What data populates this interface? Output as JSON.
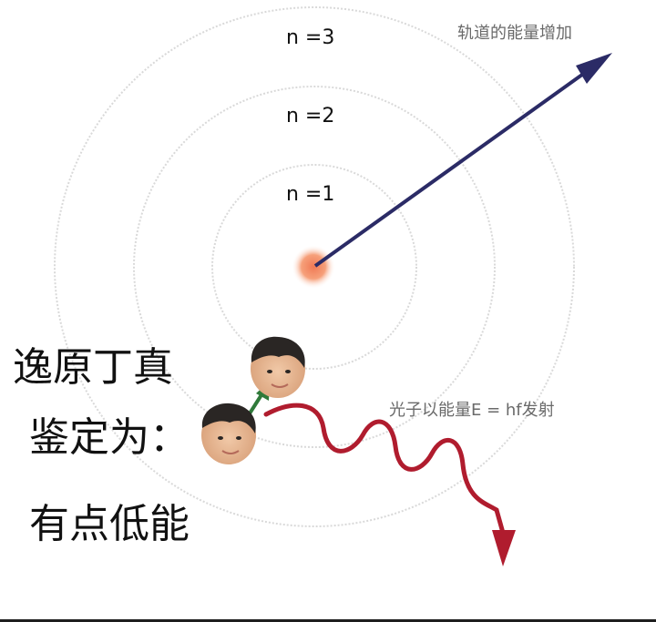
{
  "diagram": {
    "levels": [
      {
        "label": "n =1"
      },
      {
        "label": "n =2"
      },
      {
        "label": "n =3"
      }
    ],
    "arrow_label": "轨道的能量增加",
    "photon_label": "光子以能量E  =  hf发射",
    "caption_lines": [
      "逸原丁真",
      "鉴定为：",
      "有点低能"
    ],
    "colors": {
      "orbit": "#d8d8d8",
      "energy_arrow": "#2b2b66",
      "photon_wave": "#b01c2e",
      "transition_arrow": "#2f7a3a",
      "nucleus": "#f6a07a"
    }
  }
}
